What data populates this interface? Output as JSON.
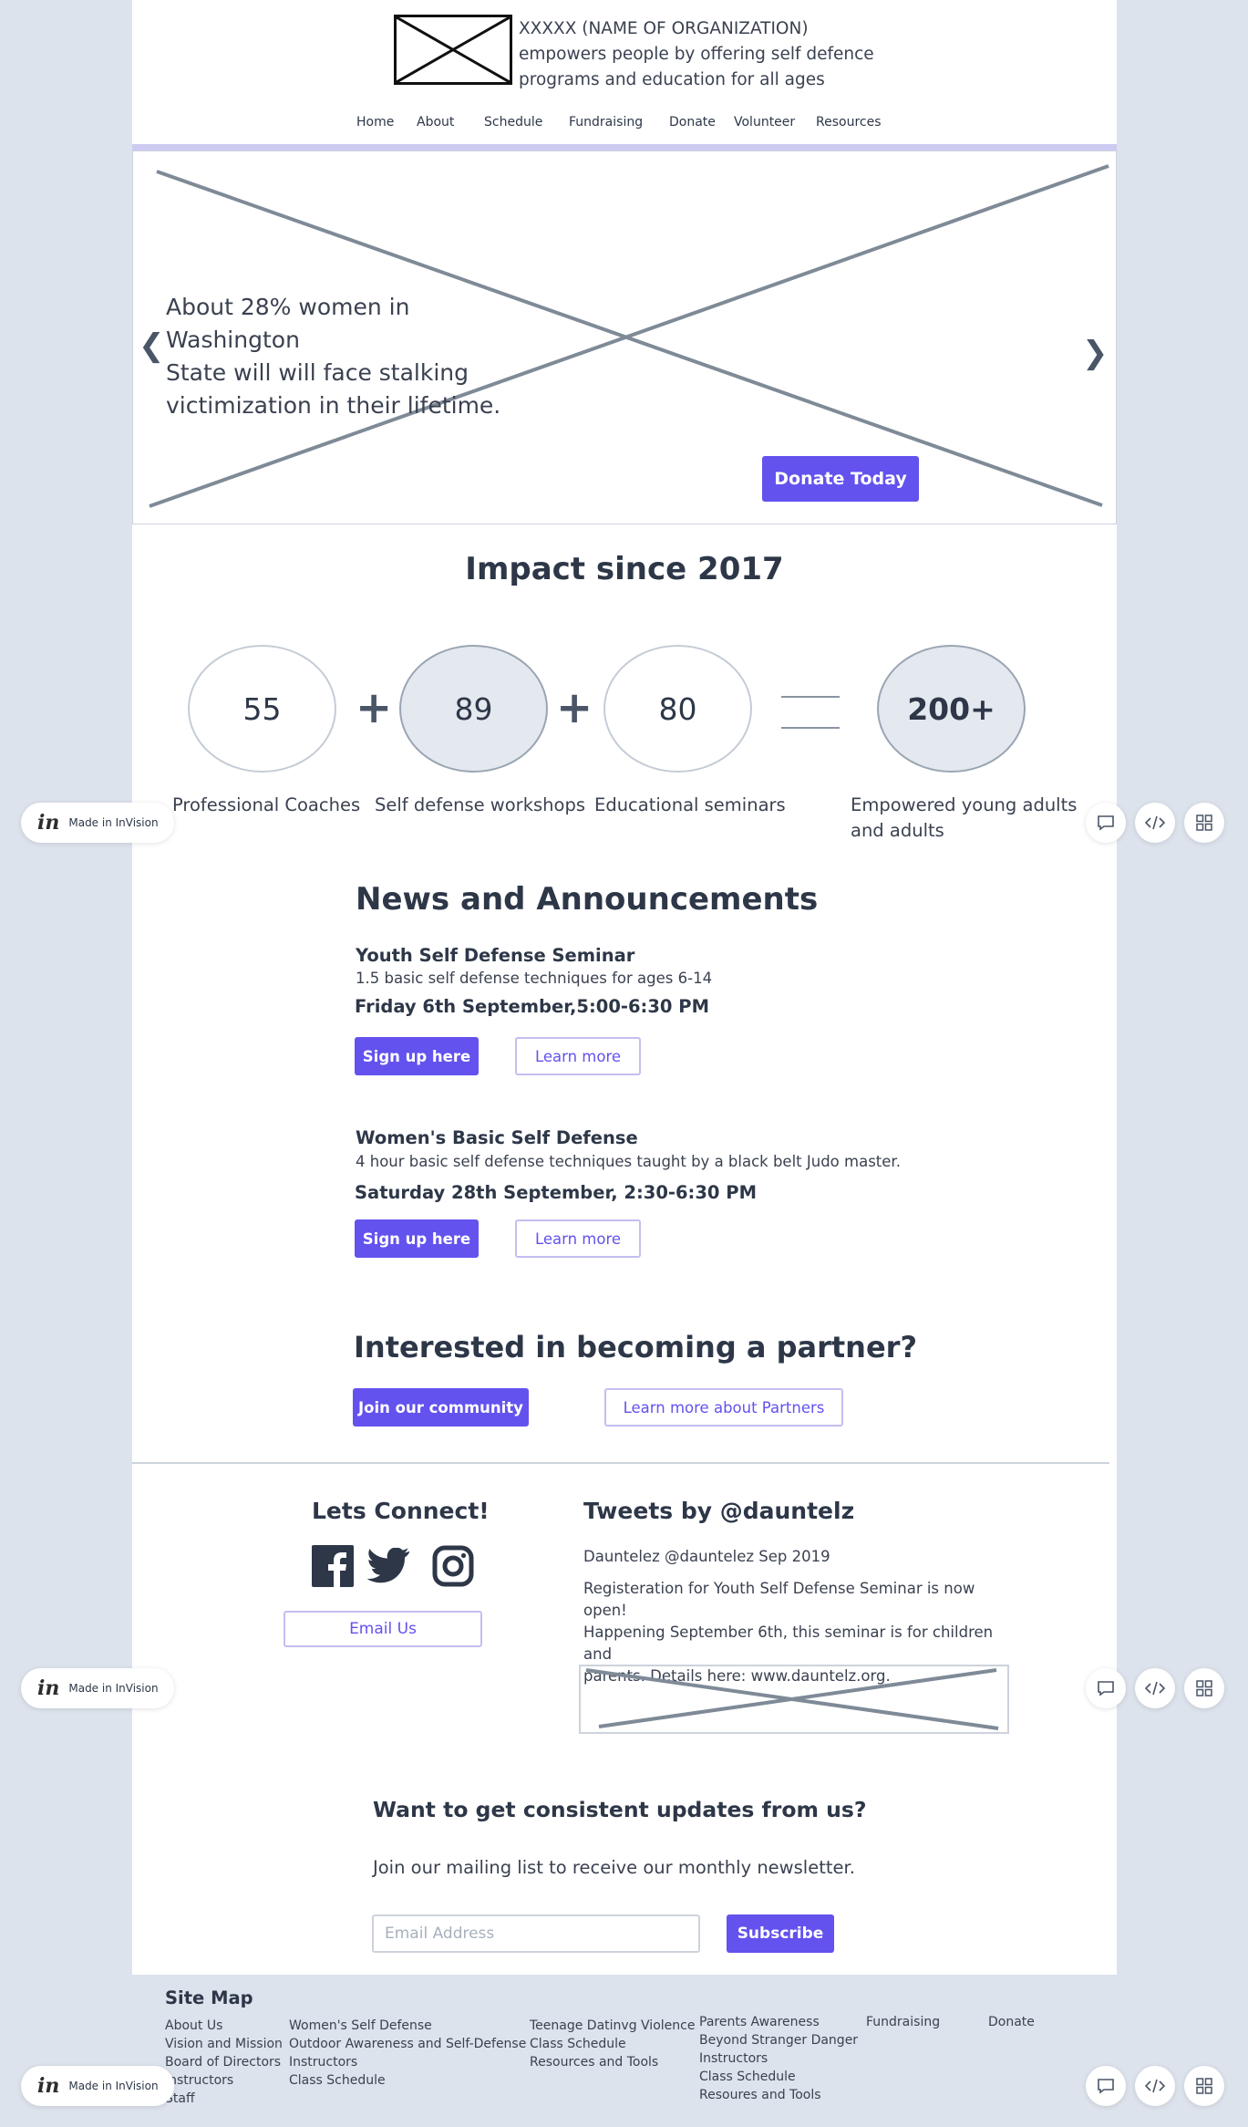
{
  "header": {
    "org_line1": "XXXXX (NAME OF ORGANIZATION)",
    "org_line2": "empowers people by offering self defence",
    "org_line3": "programs and education for all ages"
  },
  "nav": {
    "items": [
      "Home",
      "About",
      "Schedule",
      "Fundraising",
      "Donate",
      "Volunteer",
      "Resources"
    ]
  },
  "hero": {
    "line1": "About 28% women in Washington",
    "line2": "State will will face stalking",
    "line3": "victimization in their lifetime.",
    "prev_glyph": "❮",
    "next_glyph": "❯",
    "donate_label": "Donate Today"
  },
  "impact": {
    "title": "Impact since 2017",
    "stats": [
      {
        "value": "55",
        "label": "Professional Coaches"
      },
      {
        "value": "89",
        "label": "Self defense workshops"
      },
      {
        "value": "80",
        "label": "Educational seminars"
      },
      {
        "value": "200+",
        "label_line1": "Empowered young adults",
        "label_line2": "and adults"
      }
    ],
    "plus": "+"
  },
  "news": {
    "title": "News and Announcements",
    "events": [
      {
        "title": "Youth Self Defense Seminar",
        "desc": "1.5 basic self defense techniques for ages 6-14",
        "date": "Friday 6th September,5:00-6:30 PM",
        "signup": "Sign up here",
        "learn": "Learn more"
      },
      {
        "title": "Women's Basic Self Defense",
        "desc": "4 hour basic self defense techniques taught by a black belt Judo master.",
        "date": "Saturday 28th September, 2:30-6:30 PM",
        "signup": "Sign up here",
        "learn": "Learn more"
      }
    ]
  },
  "partner": {
    "title": "Interested in becoming a partner?",
    "join": "Join our community",
    "learn": "Learn more about Partners"
  },
  "connect": {
    "title": "Lets Connect!",
    "email_btn": "Email Us",
    "tweets_title": "Tweets by @dauntelz",
    "tweet_meta": "Dauntelez @dauntelez Sep 2019",
    "tweet_line1": "Registeration for Youth Self Defense Seminar is now open!",
    "tweet_line2": "Happening September 6th, this seminar is for children and",
    "tweet_line3": "parents. Details here: www.dauntelz.org."
  },
  "newsletter": {
    "title": "Want to get consistent updates from us?",
    "desc": "Join our mailing list to receive our monthly newsletter.",
    "placeholder": "Email Address",
    "subscribe": "Subscribe"
  },
  "sitemap": {
    "title": "Site Map",
    "col1": [
      "About Us",
      "Vision and Mission",
      "Board of Directors",
      "Instructors",
      "Staff"
    ],
    "col2": [
      "Women's Self Defense",
      "Outdoor Awareness and Self-Defense",
      "Instructors",
      "Class Schedule"
    ],
    "col3": [
      "Teenage Datinvg Violence",
      "Class Schedule",
      "Resources and Tools"
    ],
    "col4": [
      "Parents Awareness",
      "Beyond Stranger Danger",
      "Instructors",
      "Class Schedule",
      "Resoures and Tools"
    ],
    "col5": [
      "Fundraising"
    ],
    "col6": [
      "Donate"
    ]
  },
  "invision": {
    "logo": "in",
    "label": "Made in InVision"
  },
  "colors": {
    "accent": "#6352ee",
    "page_bg": "#dde3ec",
    "nav_bar": "#cdcbf2"
  }
}
